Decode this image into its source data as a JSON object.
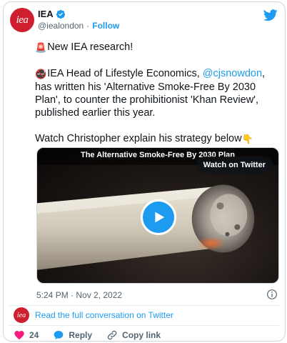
{
  "header": {
    "avatar_text": "iea",
    "display_name": "IEA",
    "handle": "@iealondon",
    "separator": "·",
    "follow_label": "Follow"
  },
  "tweet": {
    "line1_emoji": "🚨",
    "line1_text": "New IEA research!",
    "para2_emoji": "🚭",
    "para2_before": "IEA Head of Lifestyle Economics, ",
    "para2_mention": "@cjsnowdon",
    "para2_after": ", has written his 'Alternative Smoke-Free By 2030 Plan', to counter the prohibitionist 'Khan Review', published earlier this year.",
    "para3_text": "Watch Christopher explain his strategy below",
    "para3_emoji": "👇"
  },
  "media": {
    "title": "The Alternative Smoke-Free By 2030 Plan",
    "watch_label": "Watch on Twitter"
  },
  "meta": {
    "timestamp": "5:24 PM · Nov 2, 2022"
  },
  "conversation": {
    "avatar_text": "iea",
    "link_text": "Read the full conversation on Twitter"
  },
  "actions": {
    "like_count": "24",
    "reply_label": "Reply",
    "copy_label": "Copy link"
  },
  "colors": {
    "accent": "#1d9bf0",
    "brand_red": "#cf1f2e",
    "like_red": "#f91880",
    "muted": "#536471"
  }
}
